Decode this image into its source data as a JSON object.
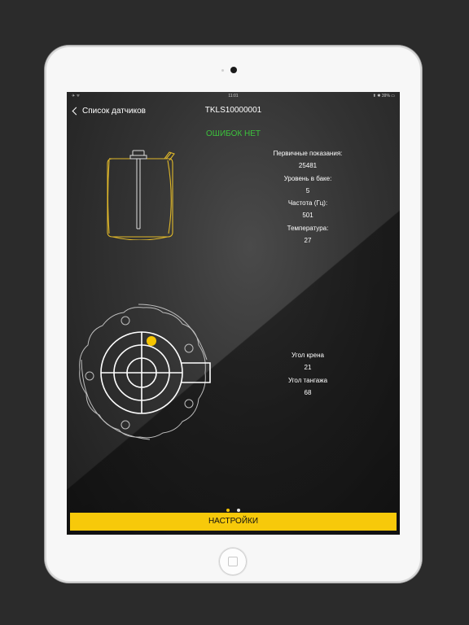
{
  "status_bar": {
    "left": "✈ ᯤ",
    "time": "11:01",
    "right": "⬆ ✱ 39% ▭"
  },
  "nav": {
    "back_label": "Список датчиков",
    "title": "TKLS10000001"
  },
  "errors_label": "ОШИБОК НЕТ",
  "readings": {
    "primary_label": "Первичные показания:",
    "primary_value": "25481",
    "level_label": "Уровень в баке:",
    "level_value": "5",
    "frequency_label": "Частота (Гц):",
    "frequency_value": "501",
    "temperature_label": "Температура:",
    "temperature_value": "27"
  },
  "angles": {
    "roll_label": "Угол крена",
    "roll_value": "21",
    "pitch_label": "Угол тангажа",
    "pitch_value": "68"
  },
  "page_indicator": {
    "count": 2,
    "active": 1
  },
  "settings_label": "НАСТРОЙКИ",
  "colors": {
    "accent": "#f7c90a",
    "ok": "#3cc23c",
    "diagram_line": "#e0b82a"
  }
}
